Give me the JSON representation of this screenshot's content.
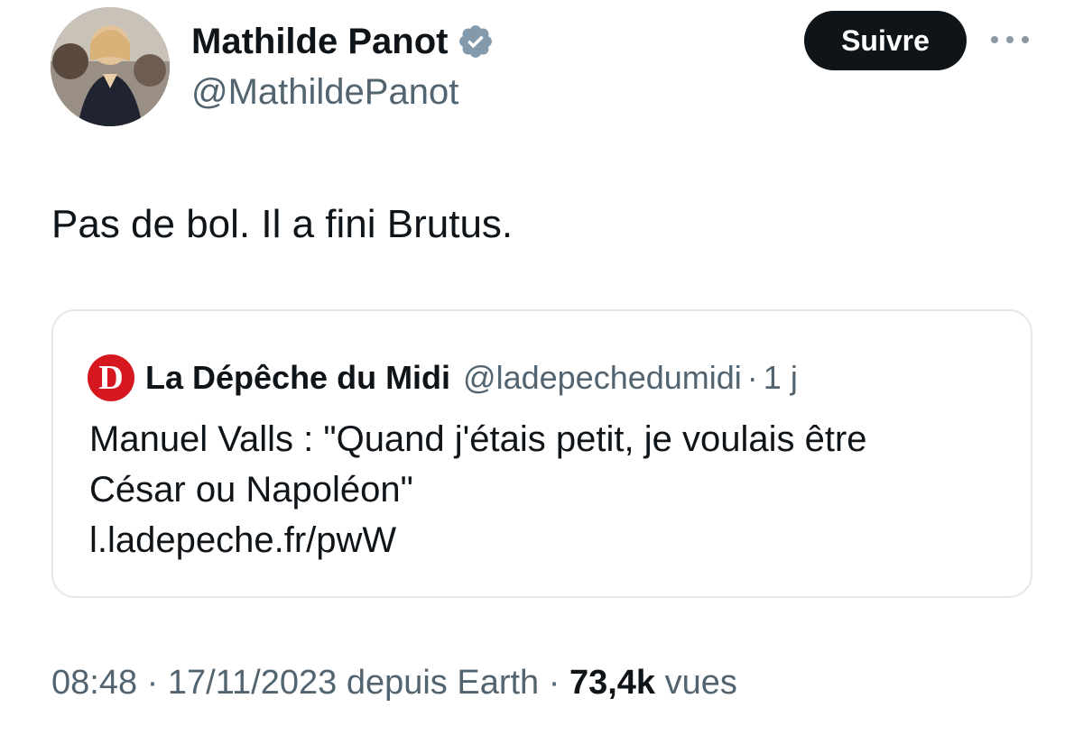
{
  "author": {
    "name": "Mathilde Panot",
    "handle": "@MathildePanot",
    "verified": true
  },
  "actions": {
    "follow_label": "Suivre"
  },
  "tweet": {
    "text": "Pas de bol. Il a fini Brutus."
  },
  "quote": {
    "logo_letter": "D",
    "source_name": "La Dépêche du Midi",
    "source_handle": "@ladepechedumidi",
    "separator": "·",
    "time": "1 j",
    "lines": [
      "Manuel Valls : \"Quand j'étais petit, je voulais être",
      "César ou Napoléon\"",
      "l.ladepeche.fr/pwW"
    ]
  },
  "meta": {
    "time": "08:48",
    "separator": "·",
    "date": "17/11/2023",
    "via": "depuis Earth",
    "views_count": "73,4k",
    "views_label": "vues"
  },
  "colors": {
    "text": "#0f1419",
    "secondary": "#536471",
    "border": "#e3e8ec",
    "button_bg": "#0f1419",
    "logo_red": "#d7171f"
  }
}
